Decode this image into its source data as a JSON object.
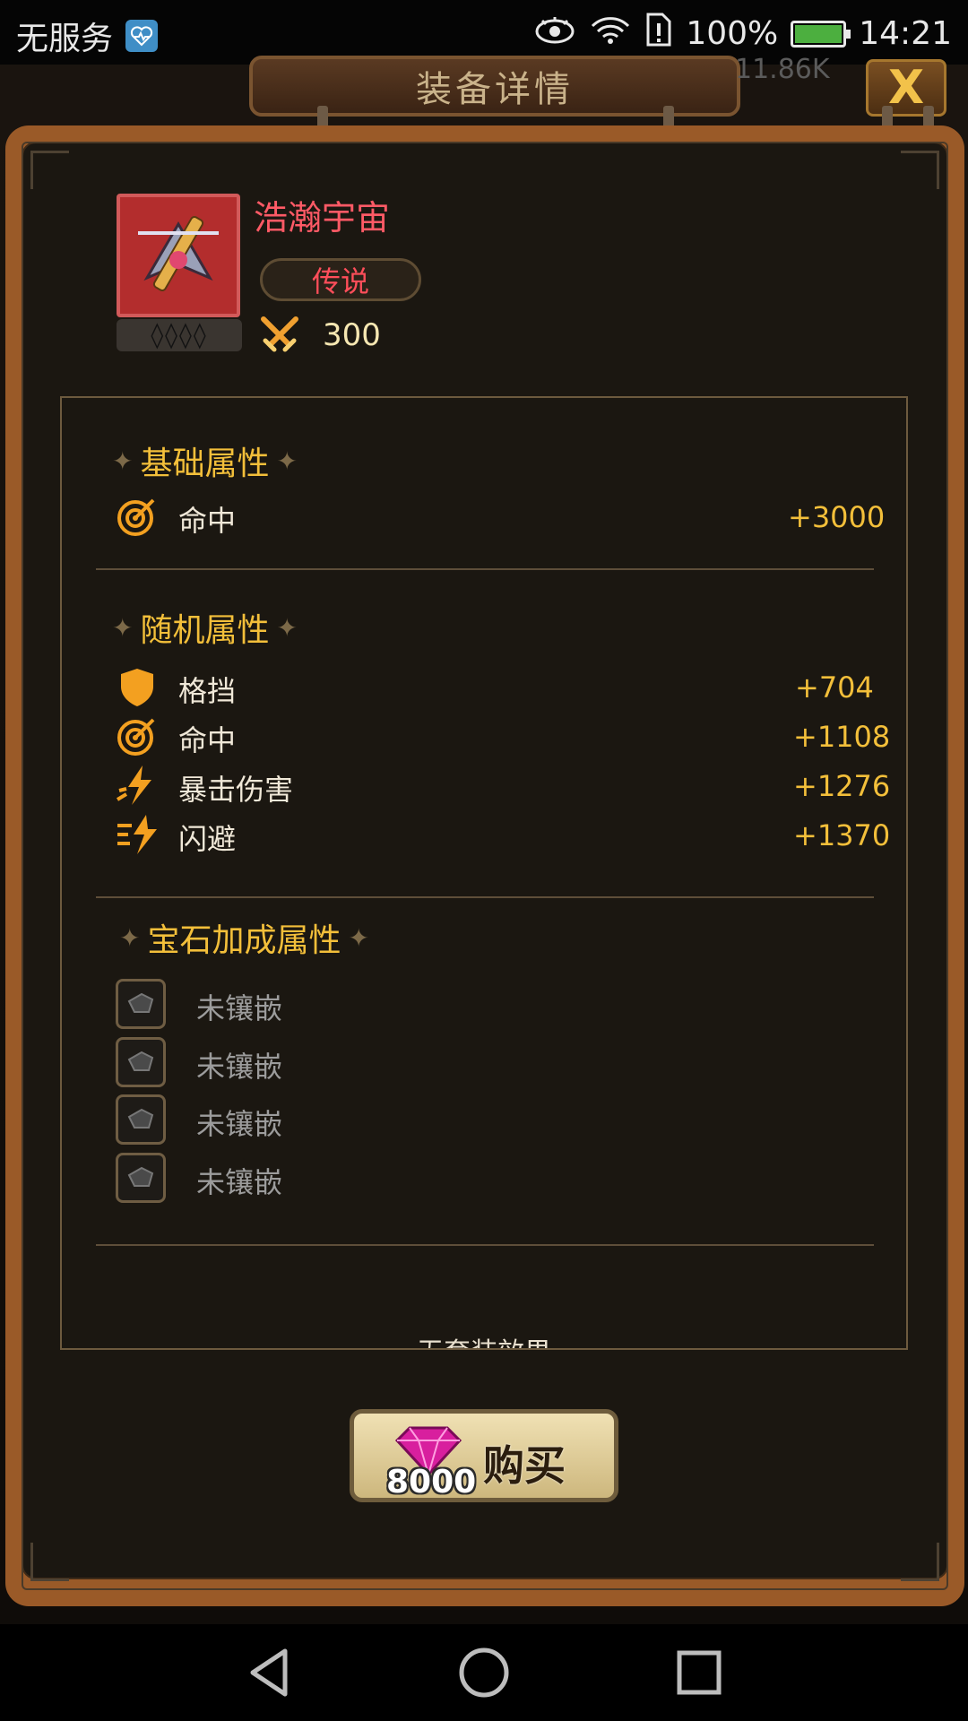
{
  "status_bar": {
    "carrier": "无服务",
    "battery_percent": "100%",
    "battery_level": 1.0,
    "time": "14:21"
  },
  "dialog": {
    "title": "装备详情",
    "peek_value": "11.86K",
    "close_label": "X"
  },
  "item": {
    "name": "浩瀚宇宙",
    "rarity": "传说",
    "gem_slots": "◊◊◊◊",
    "power": "300"
  },
  "sections": {
    "basic": {
      "title": "基础属性",
      "rows": [
        {
          "icon": "target-icon",
          "name": "命中",
          "value": "+3000"
        }
      ]
    },
    "random": {
      "title": "随机属性",
      "rows": [
        {
          "icon": "shield-icon",
          "name": "格挡",
          "value": "+704"
        },
        {
          "icon": "target-icon",
          "name": "命中",
          "value": "+1108"
        },
        {
          "icon": "crit-icon",
          "name": "暴击伤害",
          "value": "+1276"
        },
        {
          "icon": "dodge-icon",
          "name": "闪避",
          "value": "+1370"
        }
      ]
    },
    "gem": {
      "title": "宝石加成属性",
      "rows": [
        {
          "name": "未镶嵌"
        },
        {
          "name": "未镶嵌"
        },
        {
          "name": "未镶嵌"
        },
        {
          "name": "未镶嵌"
        }
      ]
    },
    "set_effect": "无套装效果"
  },
  "buy": {
    "price": "8000",
    "label": "购买"
  },
  "colors": {
    "accent_gold": "#f3bf3a",
    "rarity_red": "#ff4e5a",
    "frame_brown": "#9a5a28"
  }
}
